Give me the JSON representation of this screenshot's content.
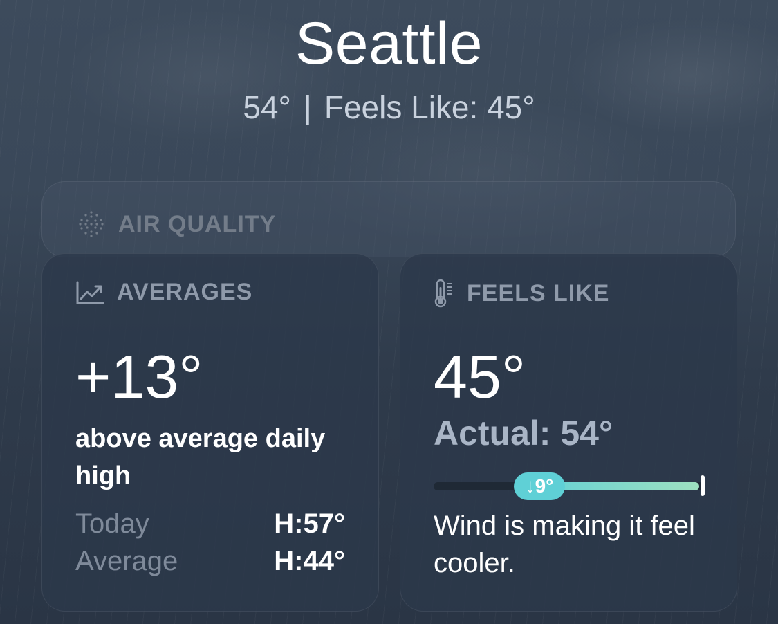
{
  "header": {
    "city": "Seattle",
    "temp": "54°",
    "separator": "|",
    "feels_like": "Feels Like: 45°"
  },
  "air_quality": {
    "title": "AIR QUALITY",
    "icon": "dots-grid-icon"
  },
  "averages": {
    "title": "AVERAGES",
    "icon": "chart-trend-icon",
    "value": "+13°",
    "description": "above average daily high",
    "rows": [
      {
        "label": "Today",
        "value": "H:57°"
      },
      {
        "label": "Average",
        "value": "H:44°"
      }
    ]
  },
  "feels_like": {
    "title": "FEELS LIKE",
    "icon": "thermometer-icon",
    "value": "45°",
    "actual": "Actual: 54°",
    "difference": "↓9°",
    "note": "Wind is making it feel cooler."
  },
  "colors": {
    "accent": "#5fd0d6",
    "gradient_end": "#9ee0c0"
  }
}
